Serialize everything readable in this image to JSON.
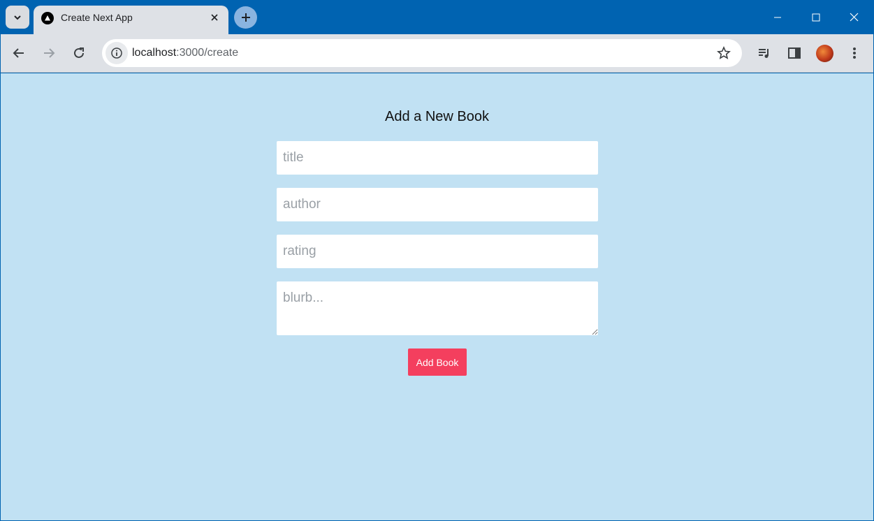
{
  "browser": {
    "tab": {
      "title": "Create Next App"
    },
    "address": {
      "host": "localhost",
      "path": ":3000/create"
    }
  },
  "form": {
    "heading": "Add a New Book",
    "title_placeholder": "title",
    "author_placeholder": "author",
    "rating_placeholder": "rating",
    "blurb_placeholder": "blurb...",
    "submit_label": "Add Book"
  },
  "colors": {
    "titlebar": "#0063b1",
    "page_background": "#c1e1f3",
    "button": "#f43f5e"
  }
}
